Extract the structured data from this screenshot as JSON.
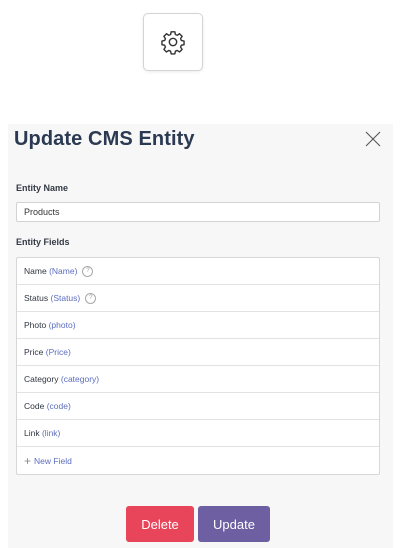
{
  "settings": {
    "icon": "gear-icon"
  },
  "modal": {
    "title": "Update CMS Entity",
    "close_icon": "close-icon",
    "entity_name_label": "Entity Name",
    "entity_name_value": "Products",
    "entity_fields_label": "Entity Fields",
    "fields": [
      {
        "label": "Name",
        "api": "(Name)",
        "help": true
      },
      {
        "label": "Status",
        "api": "(Status)",
        "help": true
      },
      {
        "label": "Photo",
        "api": "(photo)",
        "help": false
      },
      {
        "label": "Price",
        "api": "(Price)",
        "help": false
      },
      {
        "label": "Category",
        "api": "(category)",
        "help": false
      },
      {
        "label": "Code",
        "api": "(code)",
        "help": false
      },
      {
        "label": "Link",
        "api": "(link)",
        "help": false
      }
    ],
    "new_field_label": "New Field",
    "delete_label": "Delete",
    "update_label": "Update",
    "help_glyph": "?",
    "plus_glyph": "+",
    "colors": {
      "title": "#2b3a52",
      "link": "#5b6dbf",
      "delete": "#e8445a",
      "update": "#6e5fa3",
      "panel_bg": "#f7f7f7"
    }
  }
}
